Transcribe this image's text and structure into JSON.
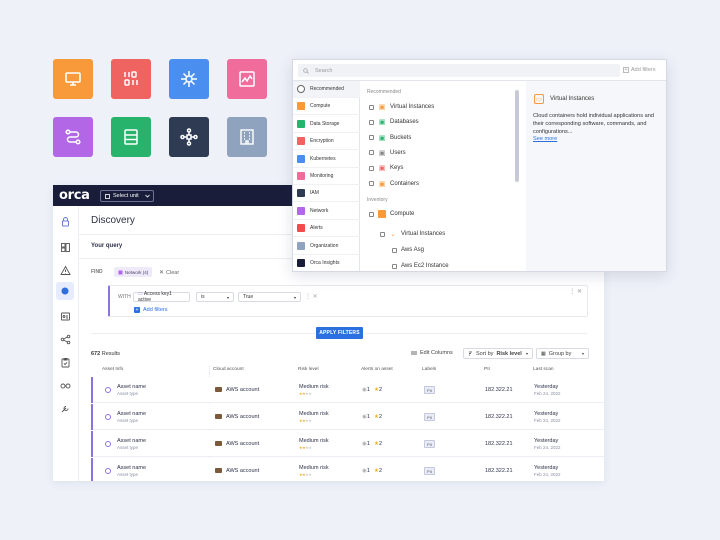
{
  "colors": {
    "tile_orange": "#f8993a",
    "tile_red": "#ef6461",
    "tile_blue": "#4a8ff0",
    "tile_pink": "#f06c9b",
    "tile_purple": "#b267e6",
    "tile_green": "#27b36b",
    "tile_navy": "#2f3b52",
    "tile_slate": "#8fa3bf",
    "topbar": "#1a1d3a",
    "primary": "#2c6fe0",
    "accent_purple": "#8d72e1"
  },
  "tiles": [
    "monitor-icon",
    "binary-icon",
    "kubernetes-icon",
    "monitoring-chart-icon",
    "workflow-icon",
    "storage-icon",
    "network-icon",
    "building-icon"
  ],
  "app": {
    "logo": "orca",
    "unit_select": "Select unit",
    "page_title": "Discovery",
    "query_label": "Your query",
    "find_label": "FIND",
    "find_chip": "Network (4)",
    "clear_label": "Clear",
    "with_label": "WITH",
    "condition": {
      "field": "Access key1 active",
      "operator": "is",
      "value": "True"
    },
    "add_filters": "Add filters",
    "apply_button": "APPLY FILTERS",
    "results_count": "672",
    "results_label": "Results",
    "edit_columns": "Edit Columns",
    "sort_by_prefix": "Sort by",
    "sort_by_value": "Risk level",
    "group_by": "Group by",
    "columns": [
      "Asset Info",
      "Cloud account",
      "Risk level",
      "Alerts on asset",
      "Labels",
      "PII",
      "Last scan"
    ],
    "rows": [
      {
        "asset_name": "Asset name",
        "asset_type": "Asset type",
        "cloud_account": "AWS account",
        "risk": "Medium risk",
        "alerts_gray": "1",
        "alerts_yellow": "2",
        "label": "PII",
        "ip": "182.322.21",
        "last_scan": "Yesterday",
        "date": "Feb 24, 2022"
      },
      {
        "asset_name": "Asset name",
        "asset_type": "Asset type",
        "cloud_account": "AWS account",
        "risk": "Medium risk",
        "alerts_gray": "1",
        "alerts_yellow": "2",
        "label": "PII",
        "ip": "182.322.21",
        "last_scan": "Yesterday",
        "date": "Feb 24, 2022"
      },
      {
        "asset_name": "Asset name",
        "asset_type": "Asset type",
        "cloud_account": "AWS account",
        "risk": "Medium risk",
        "alerts_gray": "1",
        "alerts_yellow": "2",
        "label": "PII",
        "ip": "182.322.21",
        "last_scan": "Yesterday",
        "date": "Feb 24, 2022"
      },
      {
        "asset_name": "Asset name",
        "asset_type": "Asset type",
        "cloud_account": "AWS account",
        "risk": "Medium risk",
        "alerts_gray": "1",
        "alerts_yellow": "2",
        "label": "PII",
        "ip": "182.322.21",
        "last_scan": "Yesterday",
        "date": "Feb 24, 2022"
      }
    ]
  },
  "panel": {
    "search_placeholder": "Search",
    "add_filters": "Add filters",
    "categories": [
      {
        "label": "Recommended",
        "color": "#ffffff",
        "icon": "star-icon"
      },
      {
        "label": "Compute",
        "color": "#f8993a",
        "icon": "compute-icon"
      },
      {
        "label": "Data Storage",
        "color": "#27b36b",
        "icon": "storage-icon"
      },
      {
        "label": "Encryption",
        "color": "#ef6461",
        "icon": "encryption-icon"
      },
      {
        "label": "Kubernetes",
        "color": "#4a8ff0",
        "icon": "kubernetes-icon"
      },
      {
        "label": "Monitoring",
        "color": "#f06c9b",
        "icon": "monitoring-icon"
      },
      {
        "label": "IAM",
        "color": "#2f3b52",
        "icon": "iam-icon"
      },
      {
        "label": "Network",
        "color": "#b267e6",
        "icon": "network-icon"
      },
      {
        "label": "Alerts",
        "color": "#ef4d4d",
        "icon": "alert-icon"
      },
      {
        "label": "Organization",
        "color": "#8fa3bf",
        "icon": "organization-icon"
      },
      {
        "label": "Orca Insights",
        "color": "#1a1d3a",
        "icon": "orca-icon"
      }
    ],
    "recommended_label": "Recommended",
    "recommended": [
      {
        "label": "Virtual Instances",
        "icon_color": "#f8993a"
      },
      {
        "label": "Databases",
        "icon_color": "#27b36b"
      },
      {
        "label": "Buckets",
        "icon_color": "#27b36b"
      },
      {
        "label": "Users",
        "icon_color": "#888888"
      },
      {
        "label": "Keys",
        "icon_color": "#ef6461"
      },
      {
        "label": "Containers",
        "icon_color": "#f8993a"
      }
    ],
    "inventory_label": "Inventory",
    "inventory": [
      {
        "label": "Compute"
      },
      {
        "label": "Virtual Instances"
      },
      {
        "label": "Aws Asg"
      },
      {
        "label": "Aws Ec2 Instance"
      }
    ],
    "detail": {
      "title": "Virtual Instances",
      "description": "Cloud containers hold individual applications and their corresponding software, commands, and configurations...",
      "link": "See more"
    }
  }
}
